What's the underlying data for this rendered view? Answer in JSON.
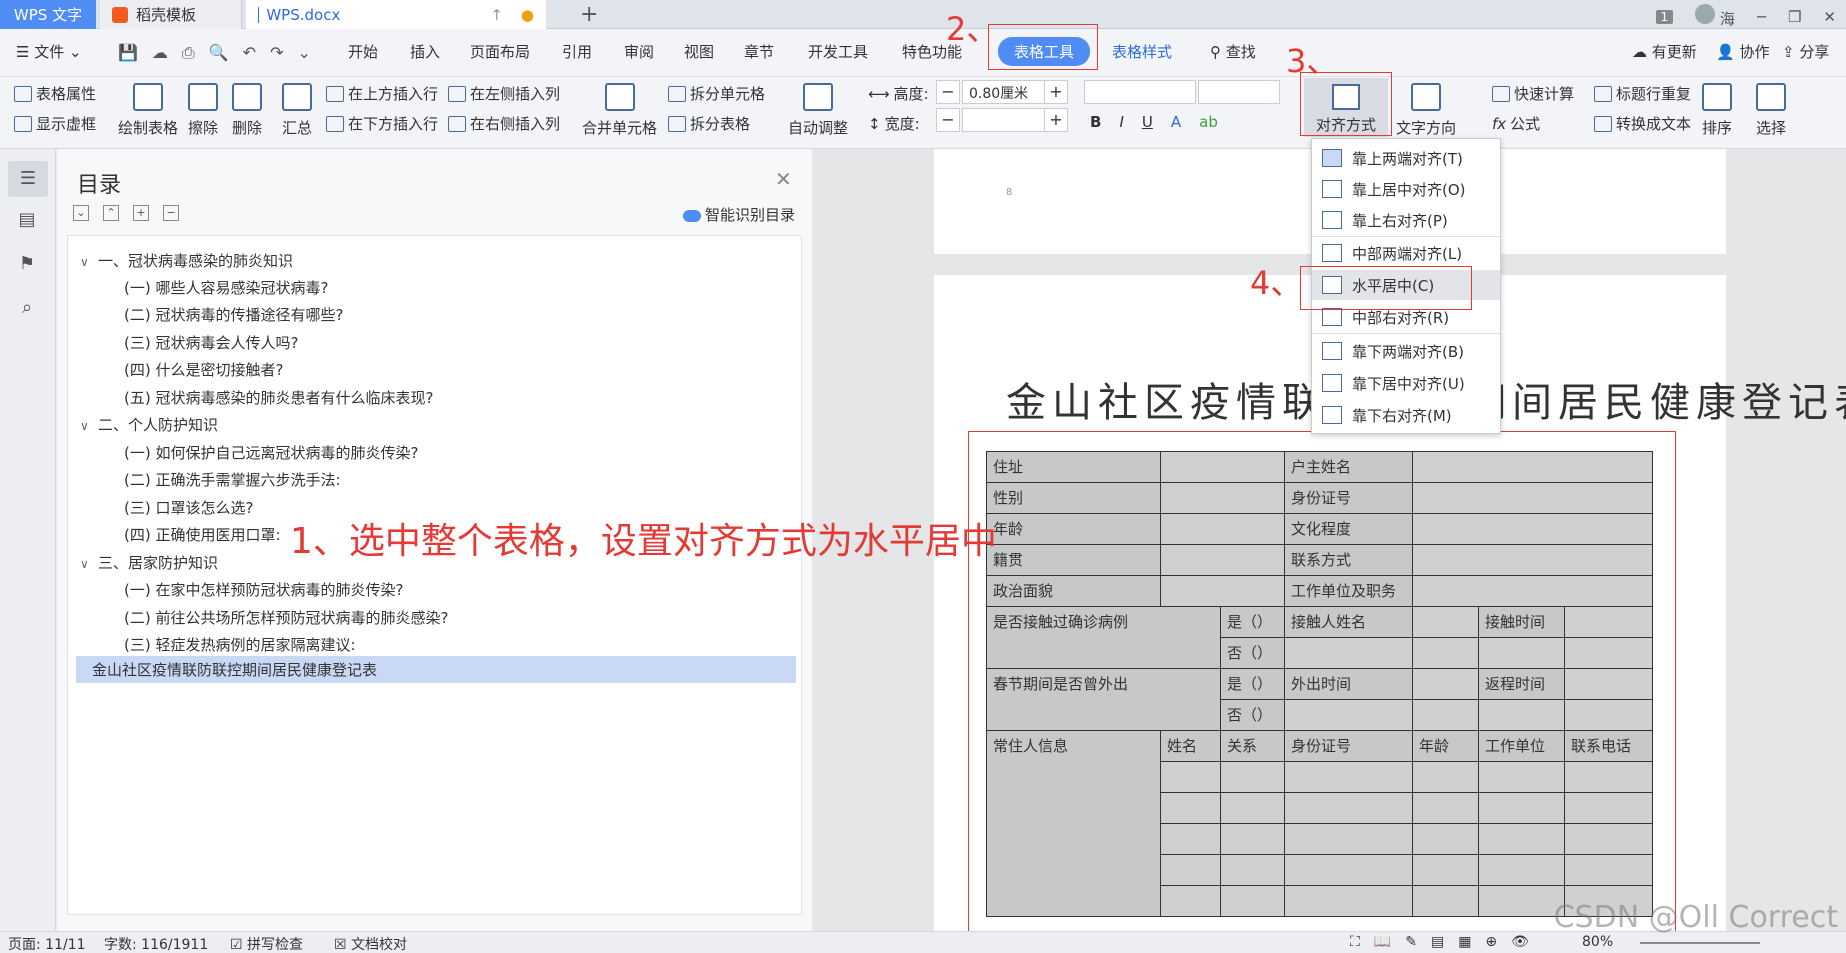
{
  "tabs": {
    "app": "WPS 文字",
    "template": "稻壳模板",
    "document": "WPS.docx",
    "new": "+"
  },
  "window": {
    "badge": "1",
    "user": "海"
  },
  "menubar": {
    "file": "文件",
    "items": [
      "开始",
      "插入",
      "页面布局",
      "引用",
      "审阅",
      "视图",
      "章节",
      "开发工具",
      "特色功能"
    ],
    "table_tools": "表格工具",
    "table_style": "表格样式",
    "find": "查找",
    "update": "有更新",
    "collab": "协作",
    "share": "分享"
  },
  "ribbon": {
    "table_props": "表格属性",
    "show_grid": "显示虚框",
    "draw_table": "绘制表格",
    "erase": "擦除",
    "delete": "删除",
    "summary": "汇总",
    "insert_above": "在上方插入行",
    "insert_below": "在下方插入行",
    "insert_left": "在左侧插入列",
    "insert_right": "在右侧插入列",
    "merge": "合并单元格",
    "split_cell": "拆分单元格",
    "split_table": "拆分表格",
    "auto_fit": "自动调整",
    "height_label": "高度:",
    "height_value": "0.80厘米",
    "width_label": "宽度:",
    "width_value": "",
    "align": "对齐方式",
    "text_dir": "文字方向",
    "quick_calc": "快速计算",
    "title_repeat": "标题行重复",
    "formula": "公式",
    "to_text": "转换成文本",
    "sort": "排序",
    "select": "选择"
  },
  "align_menu": [
    "靠上两端对齐(T)",
    "靠上居中对齐(O)",
    "靠上右对齐(P)",
    "中部两端对齐(L)",
    "水平居中(C)",
    "中部右对齐(R)",
    "靠下两端对齐(B)",
    "靠下居中对齐(U)",
    "靠下右对齐(M)"
  ],
  "toc": {
    "title": "目录",
    "smart": "智能识别目录",
    "items": [
      "一、冠状病毒感染的肺炎知识",
      "(一) 哪些人容易感染冠状病毒?",
      "(二) 冠状病毒的传播途径有哪些?",
      "(三) 冠状病毒会人传人吗?",
      "(四) 什么是密切接触者?",
      "(五) 冠状病毒感染的肺炎患者有什么临床表现?",
      "二、个人防护知识",
      "(一) 如何保护自己远离冠状病毒的肺炎传染?",
      "(二) 正确洗手需掌握六步洗手法:",
      "(三) 口罩该怎么选?",
      "(四) 正确使用医用口罩:",
      "三、居家防护知识",
      "(一) 在家中怎样预防冠状病毒的肺炎传染?",
      "(二) 前往公共场所怎样预防冠状病毒的肺炎感染?",
      "(三) 轻症发热病例的居家隔离建议:",
      "金山社区疫情联防联控期间居民健康登记表"
    ]
  },
  "document": {
    "title": "金山社区疫情联防联控期间居民健康登记表",
    "page1_mark": "8",
    "table": {
      "address": "住址",
      "head_name": "户主姓名",
      "gender": "性别",
      "id_no": "身份证号",
      "age": "年龄",
      "education": "文化程度",
      "native": "籍贯",
      "contact": "联系方式",
      "political": "政治面貌",
      "workplace": "工作单位及职务",
      "exposure_q": "是否接触过确诊病例",
      "yes": "是（）",
      "no": "否（）",
      "contact_name": "接触人姓名",
      "contact_time": "接触时间",
      "travel_q": "春节期间是否曾外出",
      "out_time": "外出时间",
      "return_time": "返程时间",
      "residents": "常住人信息",
      "name": "姓名",
      "relation": "关系",
      "res_id": "身份证号",
      "res_age": "年龄",
      "res_work": "工作单位",
      "res_phone": "联系电话"
    }
  },
  "annotations": {
    "step1": "1、选中整个表格，设置对齐方式为水平居中",
    "step2": "2、",
    "step3": "3、",
    "step4": "4、"
  },
  "status": {
    "page": "页面: 11/11",
    "words": "字数: 116/1911",
    "spell": "拼写检查",
    "proof": "文档校对",
    "zoom": "80%"
  },
  "watermark": "CSDN @Oll Correct",
  "colors": {
    "accent": "#4f8df5",
    "annotation": "#e53935",
    "selected": "#c9d9f5"
  }
}
